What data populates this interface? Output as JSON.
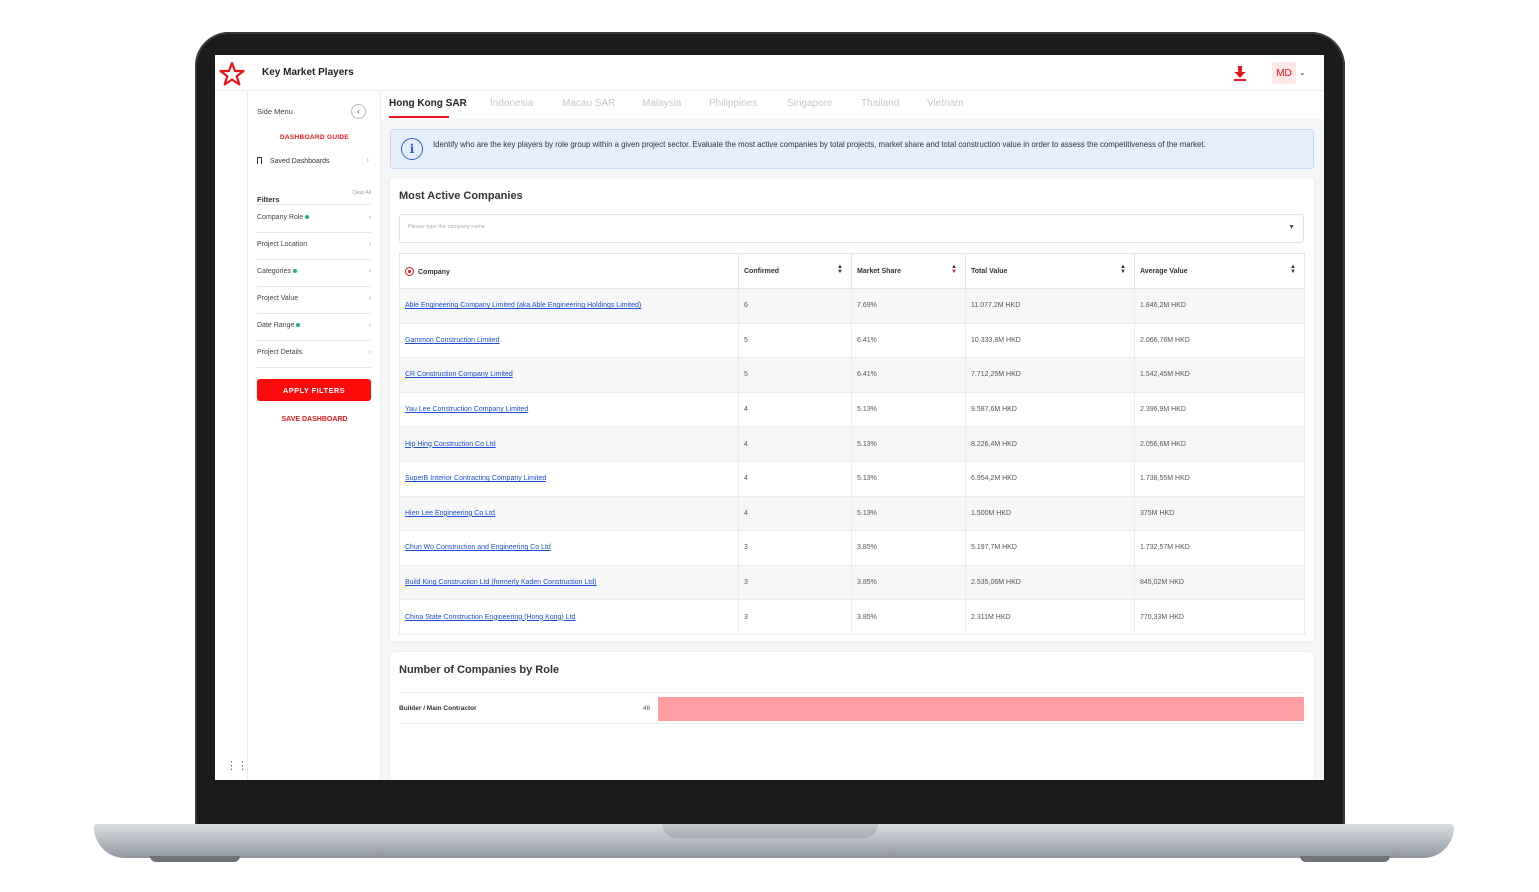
{
  "app": {
    "title": "Key Market Players",
    "avatar_initials": "MD"
  },
  "colors": {
    "brand_red": "#e8161b",
    "bar_fill": "#ff9fa3",
    "link_blue": "#1a4fd6",
    "info_bg": "#e6eefc"
  },
  "side_menu": {
    "title": "Side Menu",
    "dashboard_guide": "DASHBOARD GUIDE",
    "saved_dashboards": "Saved Dashboards",
    "filters_label": "Filters",
    "clear_all": "Clear All",
    "filters": [
      {
        "label": "Company Role",
        "active": true
      },
      {
        "label": "Project Location",
        "active": false
      },
      {
        "label": "Categories",
        "active": true
      },
      {
        "label": "Project Value",
        "active": false
      },
      {
        "label": "Date Range",
        "active": true
      },
      {
        "label": "Project Details",
        "active": false
      }
    ],
    "apply_filters": "APPLY FILTERS",
    "save_dashboard": "SAVE DASHBOARD"
  },
  "tabs": [
    {
      "label": "Hong Kong SAR",
      "active": true
    },
    {
      "label": "Indonesia",
      "active": false
    },
    {
      "label": "Macau SAR",
      "active": false
    },
    {
      "label": "Malaysia",
      "active": false
    },
    {
      "label": "Philippines",
      "active": false
    },
    {
      "label": "Singapore",
      "active": false
    },
    {
      "label": "Thailand",
      "active": false
    },
    {
      "label": "Vietnam",
      "active": false
    }
  ],
  "info_text": "Identify who are the key players by role group within a given project sector. Evaluate the most active companies by total projects, market share and total construction value in order to assess the competitiveness of the market.",
  "most_active": {
    "title": "Most Active Companies",
    "search_placeholder": "Please type the company name",
    "columns": [
      "Company",
      "Confirmed",
      "Market Share",
      "Total Value",
      "Average Value"
    ],
    "rows": [
      [
        "Able Engineering Company Limited (aka Able Engineering Holdings Limited)",
        "6",
        "7.69%",
        "11.077,2M HKD",
        "1.846,2M HKD"
      ],
      [
        "Gammon Construction Limited",
        "5",
        "6.41%",
        "10.333,8M HKD",
        "2.066,76M HKD"
      ],
      [
        "CR Construction Company Limited",
        "5",
        "6.41%",
        "7.712,25M HKD",
        "1.542,45M HKD"
      ],
      [
        "Yau Lee Construction Company Limited",
        "4",
        "5.13%",
        "9.587,6M HKD",
        "2.396,9M HKD"
      ],
      [
        "Hip Hing Construction Co Ltd",
        "4",
        "5.13%",
        "8.226,4M HKD",
        "2.056,6M HKD"
      ],
      [
        "SuperB Interior Contracting Company Limited",
        "4",
        "5.13%",
        "6.954,2M HKD",
        "1.738,55M HKD"
      ],
      [
        "Hien Lee Engineering Co Ltd",
        "4",
        "5.13%",
        "1.500M HKD",
        "375M HKD"
      ],
      [
        "Chun Wo Construction and Engineering Co Ltd",
        "3",
        "3.85%",
        "5.197,7M HKD",
        "1.732,57M HKD"
      ],
      [
        "Build King Construction Ltd (formerly Kaden Construction Ltd)",
        "3",
        "3.85%",
        "2.535,06M HKD",
        "845,02M HKD"
      ],
      [
        "China State Construction Engineering (Hong Kong) Ltd",
        "3",
        "3.85%",
        "2.311M HKD",
        "770,33M HKD"
      ]
    ]
  },
  "by_role": {
    "title": "Number of Companies by Role",
    "rows": [
      {
        "label": "Builder / Main Contractor",
        "value": 46,
        "fraction": 1.0
      }
    ]
  }
}
